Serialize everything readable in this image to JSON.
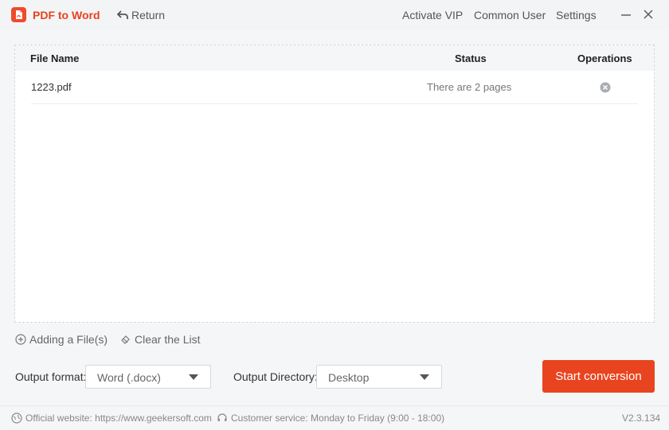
{
  "app": {
    "title": "PDF to Word",
    "return_label": "Return",
    "top_links": [
      "Activate VIP",
      "Common User",
      "Settings"
    ]
  },
  "table": {
    "headers": {
      "file_name": "File Name",
      "status": "Status",
      "operations": "Operations"
    },
    "rows": [
      {
        "file_name": "1223.pdf",
        "status": "There are 2 pages"
      }
    ]
  },
  "actions": {
    "add_files": "Adding a File(s)",
    "clear_list": "Clear the List"
  },
  "output": {
    "format_label": "Output format:",
    "format_value": "Word (.docx)",
    "directory_label": "Output Directory:",
    "directory_value": "Desktop",
    "start_label": "Start conversion"
  },
  "footer": {
    "website": "Official website: https://www.geekersoft.com",
    "service": "Customer service: Monday to Friday (9:00 - 18:00)",
    "version": "V2.3.134"
  },
  "colors": {
    "accent": "#e94420",
    "title": "#e8421f"
  },
  "icons": [
    "app-logo-icon",
    "return-arrow-icon",
    "minimize-icon",
    "close-icon",
    "remove-file-icon",
    "add-circle-icon",
    "eraser-icon",
    "dropdown-caret-icon",
    "globe-icon",
    "headset-icon"
  ]
}
